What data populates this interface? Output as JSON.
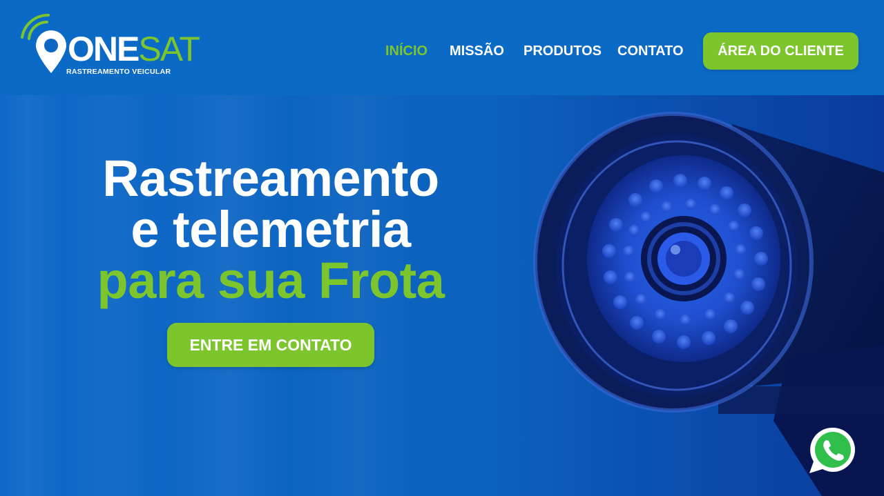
{
  "brand": {
    "logo_one": "ONE",
    "logo_sat": "SAT",
    "tagline": "RASTREAMENTO VEICULAR"
  },
  "nav": {
    "items": [
      {
        "label": "INÍCIO",
        "active": true
      },
      {
        "label": "MISSÃO",
        "active": false
      },
      {
        "label": "PRODUTOS",
        "active": false
      },
      {
        "label": "CONTATO",
        "active": false
      }
    ],
    "client_area_label": "ÁREA DO CLIENTE"
  },
  "hero": {
    "title_line1": "Rastreamento",
    "title_line2": "e telemetria",
    "title_line3": "para sua Frota",
    "cta_label": "ENTRE EM CONTATO"
  },
  "icons": {
    "camera": "security-camera-illustration",
    "whatsapp": "whatsapp-icon",
    "logo_pin": "location-pin-icon",
    "logo_signal": "signal-waves-icon"
  },
  "colors": {
    "primary_blue": "#0b66c4",
    "accent_green": "#7cc52c",
    "text_white": "#ffffff"
  }
}
